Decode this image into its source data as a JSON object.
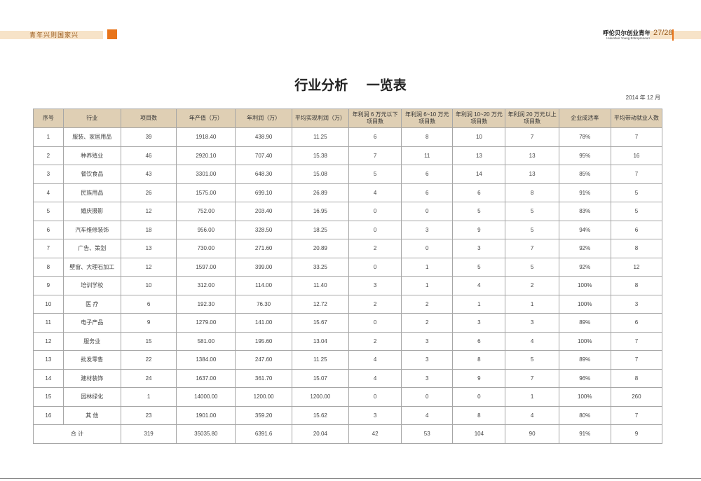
{
  "header": {
    "slogan": "青年兴则国家兴",
    "brand_title": "呼伦贝尔创业青年",
    "brand_subtitle": "Hulunbuir Young Entrepreneurs",
    "page_number": "27/28",
    "accent_color": "#e8741a",
    "band_color": "#f7e3c8"
  },
  "document": {
    "title": "行业分析    一览表",
    "date": "2014 年 12 月"
  },
  "table": {
    "header_color": "#dfcfb4",
    "columns": [
      "序号",
      "行业",
      "项目数",
      "年产值（万）",
      "年利润（万）",
      "平均实现利润（万）",
      "年利润 6 万元以下项目数",
      "年利润 6~10 万元项目数",
      "年利润 10~20 万元项目数",
      "年利润 20 万元以上项目数",
      "企业成活率",
      "平均带动就业人数"
    ],
    "rows": [
      [
        "1",
        "服装、家居用品",
        "39",
        "1918.40",
        "438.90",
        "11.25",
        "6",
        "8",
        "10",
        "7",
        "78%",
        "7"
      ],
      [
        "2",
        "种养殖业",
        "46",
        "2920.10",
        "707.40",
        "15.38",
        "7",
        "11",
        "13",
        "13",
        "95%",
        "16"
      ],
      [
        "3",
        "餐饮食品",
        "43",
        "3301.00",
        "648.30",
        "15.08",
        "5",
        "6",
        "14",
        "13",
        "85%",
        "7"
      ],
      [
        "4",
        "民族用品",
        "26",
        "1575.00",
        "699.10",
        "26.89",
        "4",
        "6",
        "6",
        "8",
        "91%",
        "5"
      ],
      [
        "5",
        "婚庆摄影",
        "12",
        "752.00",
        "203.40",
        "16.95",
        "0",
        "0",
        "5",
        "5",
        "83%",
        "5"
      ],
      [
        "6",
        "汽车维修装饰",
        "18",
        "956.00",
        "328.50",
        "18.25",
        "0",
        "3",
        "9",
        "5",
        "94%",
        "6"
      ],
      [
        "7",
        "广告、策划",
        "13",
        "730.00",
        "271.60",
        "20.89",
        "2",
        "0",
        "3",
        "7",
        "92%",
        "8"
      ],
      [
        "8",
        "壁窗、大理石加工",
        "12",
        "1597.00",
        "399.00",
        "33.25",
        "0",
        "1",
        "5",
        "5",
        "92%",
        "12"
      ],
      [
        "9",
        "培训学校",
        "10",
        "312.00",
        "114.00",
        "11.40",
        "3",
        "1",
        "4",
        "2",
        "100%",
        "8"
      ],
      [
        "10",
        "医  疗",
        "6",
        "192.30",
        "76.30",
        "12.72",
        "2",
        "2",
        "1",
        "1",
        "100%",
        "3"
      ],
      [
        "11",
        "电子产品",
        "9",
        "1279.00",
        "141.00",
        "15.67",
        "0",
        "2",
        "3",
        "3",
        "89%",
        "6"
      ],
      [
        "12",
        "服务业",
        "15",
        "581.00",
        "195.60",
        "13.04",
        "2",
        "3",
        "6",
        "4",
        "100%",
        "7"
      ],
      [
        "13",
        "批发零售",
        "22",
        "1384.00",
        "247.60",
        "11.25",
        "4",
        "3",
        "8",
        "5",
        "89%",
        "7"
      ],
      [
        "14",
        "建材装饰",
        "24",
        "1637.00",
        "361.70",
        "15.07",
        "4",
        "3",
        "9",
        "7",
        "96%",
        "8"
      ],
      [
        "15",
        "园林绿化",
        "1",
        "14000.00",
        "1200.00",
        "1200.00",
        "0",
        "0",
        "0",
        "1",
        "100%",
        "260"
      ],
      [
        "16",
        "其  他",
        "23",
        "1901.00",
        "359.20",
        "15.62",
        "3",
        "4",
        "8",
        "4",
        "80%",
        "7"
      ]
    ],
    "total": {
      "label": "合  计",
      "values": [
        "319",
        "35035.80",
        "6391.6",
        "20.04",
        "42",
        "53",
        "104",
        "90",
        "91%",
        "9"
      ]
    }
  }
}
